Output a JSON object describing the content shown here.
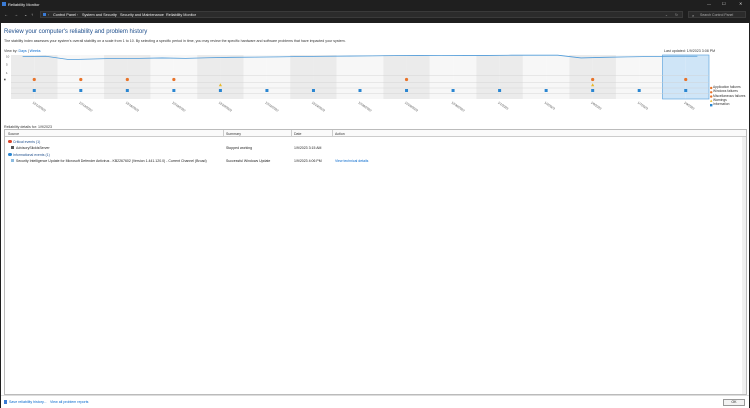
{
  "window": {
    "title": "Reliability Monitor",
    "minimize": "—",
    "maximize": "☐",
    "close": "✕"
  },
  "addressbar": {
    "crumbs": [
      "Control Panel",
      "System and Security",
      "Security and Maintenance",
      "Reliability Monitor"
    ],
    "search_placeholder": "Search Control Panel"
  },
  "header": {
    "title": "Review your computer's reliability and problem history",
    "description": "The stability index assesses your system's overall stability on a scale from 1 to 10. By selecting a specific period in time, you may review the specific hardware and software problems that have impacted your system.",
    "view_by_label": "View by:",
    "view_days": "Days",
    "view_weeks": "Weeks",
    "last_updated": "Last updated: 1/9/2023 3:08 PM"
  },
  "chart_data": {
    "type": "line",
    "y_ticks": [
      "10",
      "5",
      "1"
    ],
    "ylim": [
      1,
      10
    ],
    "x_labels": [
      "12/12/2022",
      "12/14/2022",
      "12/16/2022",
      "12/18/2022",
      "12/20/2022",
      "12/22/2022",
      "12/24/2022",
      "12/26/2022",
      "12/28/2022",
      "12/30/2022",
      "1/1/2023",
      "1/3/2023",
      "1/5/2023",
      "1/7/2023",
      "1/9/2023"
    ],
    "stability": [
      9.3,
      9.4,
      7.8,
      8.1,
      8.4,
      8.4,
      8.6,
      8.4,
      8.7,
      8.9,
      9.0,
      9.1,
      9.3,
      9.4,
      9.5,
      9.6,
      9.7,
      9.8,
      9.7,
      9.8,
      9.8,
      9.9,
      9.9,
      9.9,
      8.6,
      8.9,
      9.1,
      9.3,
      9.4,
      9.4
    ],
    "app_failure_cols": [
      0,
      2,
      4,
      6,
      16,
      24,
      28
    ],
    "warning_cols": [
      8,
      24
    ],
    "info_cols": [
      0,
      2,
      4,
      6,
      8,
      10,
      12,
      14,
      16,
      18,
      20,
      22,
      24,
      26,
      28
    ],
    "selected_col": 28,
    "colors": {
      "line": "#4f9bd9",
      "failure": "#e8732a",
      "warning": "#e8b82a",
      "info": "#2a86d1",
      "selected": "#cfe5f7"
    }
  },
  "legend": [
    "Application failures",
    "Windows failures",
    "Miscellaneous failures",
    "Warnings",
    "Information"
  ],
  "details": {
    "label": "Reliability details for: 1/9/2023",
    "columns": [
      "Source",
      "Summary",
      "Date",
      "Action"
    ],
    "groups": [
      {
        "title": "Critical events (1)",
        "color": "#d9442a",
        "rows": [
          {
            "source": "AdvisorySlicklsServer",
            "summary": "Stopped working",
            "date": "1/9/2023 3:15 AM",
            "action": ""
          }
        ]
      },
      {
        "title": "Informational events (1)",
        "color": "#2a86d1",
        "rows": [
          {
            "source": "Security Intelligence Update for Microsoft Defender Antivirus - KB2267602 (Version 1.441.120.0) - Current Channel (Broad)",
            "summary": "Successful Windows Update",
            "date": "1/9/2023 4:06 PM",
            "action": "View technical details"
          }
        ]
      }
    ]
  },
  "footer": {
    "save_history": "Save reliability history...",
    "view_all": "View all problem reports",
    "ok": "OK"
  }
}
